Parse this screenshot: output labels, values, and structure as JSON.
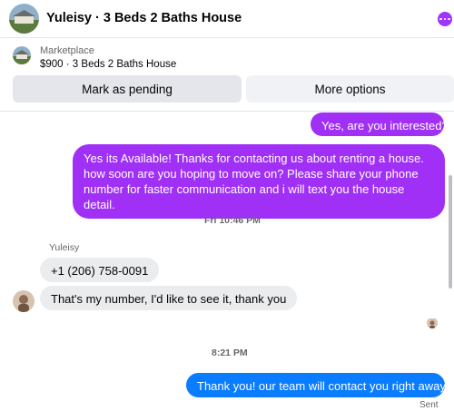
{
  "header": {
    "title": "Yuleisy · 3 Beds 2 Baths House"
  },
  "product": {
    "label": "Marketplace",
    "title": "$900 · 3 Beds 2 Baths House",
    "pending_label": "Mark as pending",
    "more_label": "More options"
  },
  "messages": {
    "out1": "Yes, are you interested?",
    "out2": "Yes its Available! Thanks for contacting us about renting a house. how soon are you hoping to move on? Please share your phone number for faster communication and i will text you the house detail.",
    "ts1": "Fri 10:46 PM",
    "sender": "Yuleisy",
    "in1": "+1 (206) 758-0091",
    "in2": "That's my number, I'd like to see it, thank you",
    "ts2": "8:21 PM",
    "out3": "Thank you! our team will contact you right away.",
    "status": "Sent"
  },
  "colors": {
    "outgoing_purple": "#a030f5",
    "outgoing_blue": "#0a7cff",
    "incoming": "#ebecee",
    "accent": "#a033ff"
  }
}
